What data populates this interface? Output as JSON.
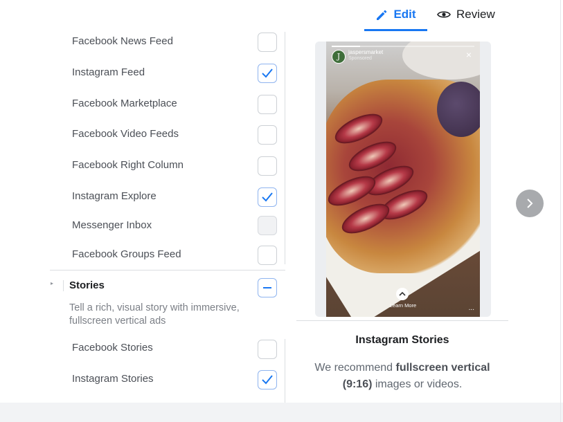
{
  "tabs": {
    "edit_label": "Edit",
    "review_label": "Review"
  },
  "placements": [
    {
      "label": "Facebook News Feed",
      "checked": false,
      "disabled": false
    },
    {
      "label": "Instagram Feed",
      "checked": true,
      "disabled": false
    },
    {
      "label": "Facebook Marketplace",
      "checked": false,
      "disabled": false
    },
    {
      "label": "Facebook Video Feeds",
      "checked": false,
      "disabled": false
    },
    {
      "label": "Facebook Right Column",
      "checked": false,
      "disabled": false
    },
    {
      "label": "Instagram Explore",
      "checked": true,
      "disabled": false
    },
    {
      "label": "Messenger Inbox",
      "checked": false,
      "disabled": true
    },
    {
      "label": "Facebook Groups Feed",
      "checked": false,
      "disabled": false
    }
  ],
  "stories_section": {
    "caret": "▸",
    "title": "Stories",
    "description": "Tell a rich, visual story with immersive, fullscreen vertical ads",
    "items": [
      {
        "label": "Facebook Stories",
        "checked": false,
        "disabled": false
      },
      {
        "label": "Instagram Stories",
        "checked": true,
        "disabled": false
      }
    ]
  },
  "story_preview": {
    "brand_name": "jaspersmarket",
    "brand_initial": "J",
    "sponsored": "Sponsored",
    "close_glyph": "×",
    "cta_label": "Learn More",
    "more_glyph": "...",
    "progress": 0.2
  },
  "preview_info": {
    "title": "Instagram Stories",
    "rec_prefix": "We recommend ",
    "rec_bold_1": "fullscreen vertical",
    "rec_bold_2": "(9:16)",
    "rec_suffix": " images or videos."
  },
  "colors": {
    "accent": "#1877f2",
    "text": "#1c1e21",
    "muted": "#606770",
    "border": "#ccd0d5"
  },
  "icons": {
    "edit": "pencil-icon",
    "review": "eye-icon",
    "check": "checkmark-icon",
    "collapse": "minus-icon",
    "next": "chevron-right-icon"
  }
}
